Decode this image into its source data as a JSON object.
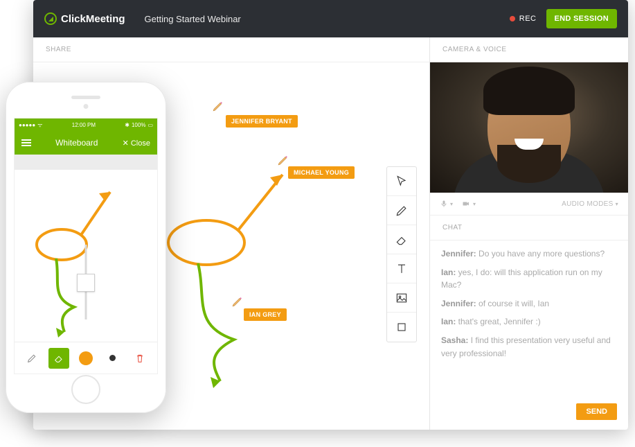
{
  "header": {
    "brand": "ClickMeeting",
    "title": "Getting Started Webinar",
    "rec": "REC",
    "end_session": "END SESSION"
  },
  "panels": {
    "share": "SHARE",
    "camera": "CAMERA & VOICE",
    "chat": "CHAT",
    "audio_modes": "AUDIO MODES"
  },
  "whiteboard": {
    "users": {
      "u1": "JENNIFER BRYANT",
      "u2": "MICHAEL YOUNG",
      "u3": "IAN GREY"
    }
  },
  "chat": {
    "messages": [
      {
        "author": "Jennifer:",
        "text": " Do you have any more questions?"
      },
      {
        "author": "Ian:",
        "text": " yes, I do: will this application run on my Mac?"
      },
      {
        "author": "Jennifer:",
        "text": " of course it will, Ian"
      },
      {
        "author": "Ian:",
        "text": " that's great, Jennifer :)"
      },
      {
        "author": "Sasha:",
        "text": " I find this presentation very useful and very professional!"
      }
    ],
    "send": "SEND"
  },
  "phone": {
    "time": "12:00 PM",
    "battery": "100%",
    "title": "Whiteboard",
    "close": "✕ Close"
  }
}
